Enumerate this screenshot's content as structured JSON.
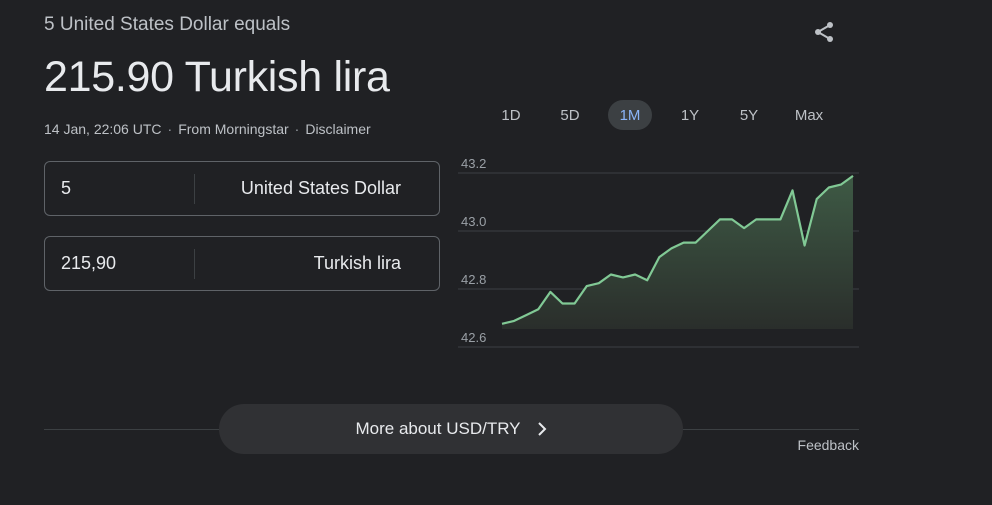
{
  "header": {
    "subtitle": "5 United States Dollar equals",
    "result": "215.90 Turkish lira",
    "timestamp": "14 Jan, 22:06 UTC",
    "source": "From Morningstar",
    "disclaimer": "Disclaimer",
    "separator": "·"
  },
  "converter": {
    "from": {
      "amount": "5",
      "currency": "United States Dollar"
    },
    "to": {
      "amount": "215,90",
      "currency": "Turkish lira"
    }
  },
  "range_tabs": [
    {
      "label": "1D",
      "active": false
    },
    {
      "label": "5D",
      "active": false
    },
    {
      "label": "1M",
      "active": true
    },
    {
      "label": "1Y",
      "active": false
    },
    {
      "label": "5Y",
      "active": false
    },
    {
      "label": "Max",
      "active": false
    }
  ],
  "more_button": {
    "label": "More about USD/TRY"
  },
  "feedback": "Feedback",
  "colors": {
    "line": "#81c995",
    "active_tab_text": "#8ab4f8",
    "background": "#202124"
  },
  "icons": {
    "share": "share-icon",
    "chevron": "chevron-right-icon"
  },
  "chart_data": {
    "type": "area",
    "title": "",
    "xlabel": "",
    "ylabel": "",
    "ylim": [
      42.6,
      43.2
    ],
    "yticks": [
      "43.2",
      "43.0",
      "42.8",
      "42.6"
    ],
    "grid": true,
    "values": [
      42.68,
      42.69,
      42.71,
      42.73,
      42.79,
      42.75,
      42.75,
      42.81,
      42.82,
      42.85,
      42.84,
      42.85,
      42.83,
      42.91,
      42.94,
      42.96,
      42.96,
      43.0,
      43.04,
      43.04,
      43.01,
      43.04,
      43.04,
      43.04,
      43.14,
      42.95,
      43.11,
      43.15,
      43.16,
      43.19
    ]
  }
}
